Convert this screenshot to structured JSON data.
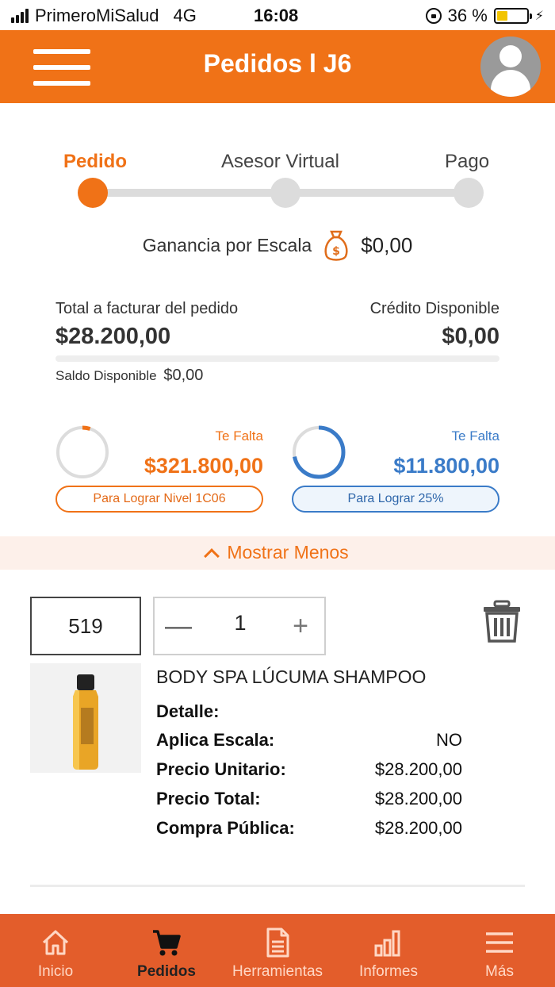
{
  "status_bar": {
    "carrier": "PrimeroMiSalud",
    "network": "4G",
    "time": "16:08",
    "battery": "36 %",
    "battery_level": 0.36
  },
  "header": {
    "title": "Pedidos l J6",
    "menu_icon": "hamburger-icon",
    "avatar_icon": "user-avatar-icon"
  },
  "steps": {
    "items": [
      "Pedido",
      "Asesor Virtual",
      "Pago"
    ],
    "active_index": 0
  },
  "ganancia": {
    "label": "Ganancia por Escala",
    "icon": "money-bag-icon",
    "amount": "$0,00"
  },
  "totals": {
    "facturar_label": "Total a facturar del pedido",
    "facturar_value": "$28.200,00",
    "credito_label": "Crédito Disponible",
    "credito_value": "$0,00",
    "saldo_label": "Saldo Disponible",
    "saldo_value": "$0,00"
  },
  "progress": {
    "left": {
      "falta_label": "Te Falta",
      "amount": "$321.800,00",
      "pill": "Para Lograr Nivel 1C06",
      "fraction": 0.05,
      "color": "#f07217"
    },
    "right": {
      "falta_label": "Te Falta",
      "amount": "$11.800,00",
      "pill": "Para Lograr 25%",
      "fraction": 0.72,
      "color": "#3a7bc8"
    }
  },
  "mostrar_menos": "Mostrar Menos",
  "product": {
    "code": "519",
    "quantity": "1",
    "minus_label": "—",
    "plus_label": "+",
    "name": "BODY SPA LÚCUMA SHAMPOO",
    "details": [
      {
        "key": "Detalle:",
        "value": ""
      },
      {
        "key": "Aplica Escala:",
        "value": "NO"
      },
      {
        "key": "Precio Unitario:",
        "value": "$28.200,00"
      },
      {
        "key": "Precio Total:",
        "value": "$28.200,00"
      },
      {
        "key": "Compra Pública:",
        "value": "$28.200,00"
      }
    ]
  },
  "tabbar": {
    "items": [
      {
        "label": "Inicio",
        "icon": "home-icon"
      },
      {
        "label": "Pedidos",
        "icon": "cart-icon"
      },
      {
        "label": "Herramientas",
        "icon": "document-icon"
      },
      {
        "label": "Informes",
        "icon": "bar-chart-icon"
      },
      {
        "label": "Más",
        "icon": "menu-icon"
      }
    ],
    "active_index": 1
  },
  "colors": {
    "brand": "#f07217",
    "tabbar": "#e35d2b",
    "blue": "#3a7bc8"
  }
}
